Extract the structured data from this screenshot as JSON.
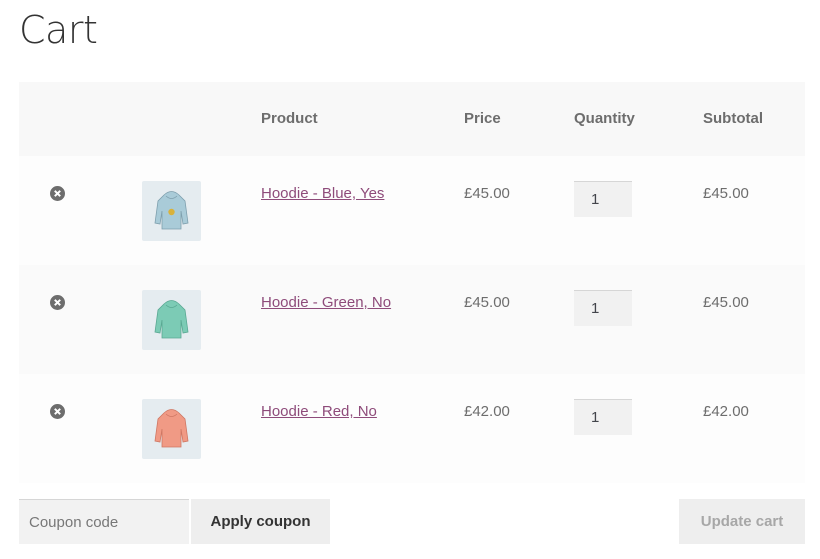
{
  "page": {
    "title": "Cart"
  },
  "table": {
    "headers": {
      "product": "Product",
      "price": "Price",
      "quantity": "Quantity",
      "subtotal": "Subtotal"
    },
    "rows": [
      {
        "name": "Hoodie - Blue, Yes",
        "price": "£45.00",
        "quantity": "1",
        "subtotal": "£45.00",
        "thumb_color": "#a9cbd8",
        "thumb_accent": "#d9b23a",
        "remove_icon": "remove-circle-x-icon"
      },
      {
        "name": "Hoodie - Green, No",
        "price": "£45.00",
        "quantity": "1",
        "subtotal": "£45.00",
        "thumb_color": "#7ccbb5",
        "thumb_accent": "",
        "remove_icon": "remove-circle-x-icon"
      },
      {
        "name": "Hoodie - Red, No",
        "price": "£42.00",
        "quantity": "1",
        "subtotal": "£42.00",
        "thumb_color": "#f09a85",
        "thumb_accent": "",
        "remove_icon": "remove-circle-x-icon"
      }
    ]
  },
  "actions": {
    "coupon_placeholder": "Coupon code",
    "coupon_value": "",
    "apply_label": "Apply coupon",
    "update_label": "Update cart"
  },
  "colors": {
    "link": "#8e4b7a",
    "header_bg": "#f8f8f8",
    "button_bg": "#eeeeee",
    "disabled_text": "#a7a7a7"
  }
}
